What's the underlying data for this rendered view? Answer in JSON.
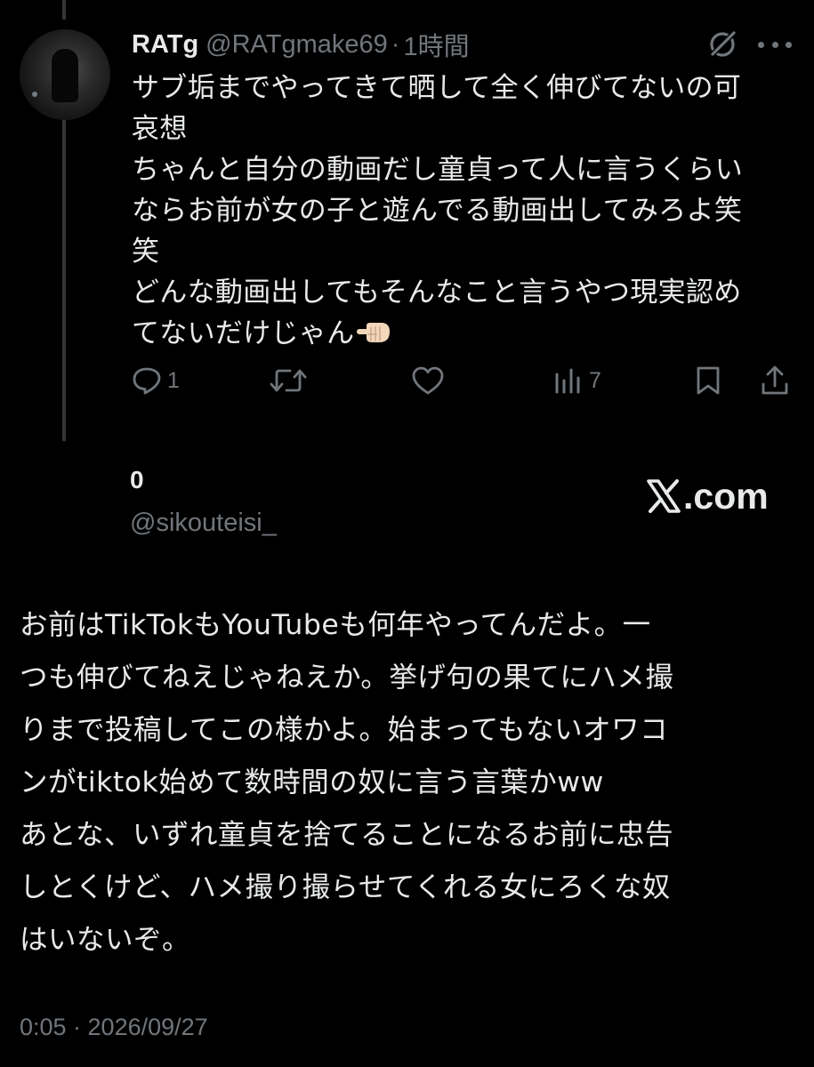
{
  "replied_tweet": {
    "author_name": "RATg",
    "author_handle": "@RATgmake69",
    "separator": "·",
    "relative_time": "1時間",
    "text": "サブ垢までやってきて晒して全く伸びてないの可\n哀想\nちゃんと自分の動画だし童貞って人に言うくらい\nならお前が女の子と遊んでる動画出してみろよ笑\n笑\nどんな動画出してもそんなこと言うやつ現実認め\nてないだけじゃん",
    "emoji": "pointing-finger-emoji",
    "actions": {
      "reply_count": "1",
      "repost_count": "",
      "like_count": "",
      "views_count": "7"
    }
  },
  "quote_author": {
    "name": "0",
    "handle": "@sikouteisi_"
  },
  "watermark": {
    "text": ".com"
  },
  "main_tweet": {
    "text": "お前はTikTokもYouTubeも何年やってんだよ。一\nつも伸びてねえじゃねえか。挙げ句の果てにハメ撮\nりまで投稿してこの様かよ。始まってもないオワコ\nンがtiktok始めて数時間の奴に言う言葉かww\nあとな、いずれ童貞を捨てることになるお前に忠告\nしとくけど、ハメ撮り撮らせてくれる女にろくな奴\nはいないぞ。",
    "timestamp": "0:05 · 2026/09/27"
  },
  "colors": {
    "background": "#000000",
    "text_primary": "#e7e9ea",
    "text_secondary": "#71767b",
    "thread_line": "#333639"
  }
}
